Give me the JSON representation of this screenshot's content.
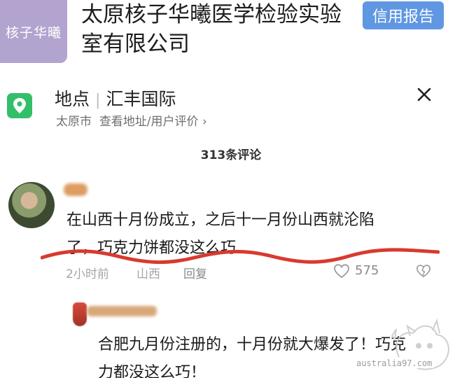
{
  "company": {
    "logo_text": "核子华曦",
    "name": "太原核子华曦医学检验实验室有限公司",
    "credit_button": "信用报告"
  },
  "location": {
    "label": "地点",
    "name": "汇丰国际",
    "city": "太原市",
    "links": "查看地址/用户评价",
    "chevron": "›",
    "icon": "map-pin-icon",
    "accent": "#33bf6a"
  },
  "comments": {
    "count": "313条评论",
    "main": {
      "text": "在山西十月份成立，之后十一月份山西就沦陷了，巧克力饼都没这么巧",
      "time": "2小时前",
      "region": "山西",
      "reply_label": "回复",
      "likes": "575"
    },
    "reply": {
      "text": "合肥九月份注册的，十月份就大爆发了！巧克力都没这么巧！"
    }
  },
  "watermark": {
    "text": "australia97.com"
  },
  "colors": {
    "credit_button": "#5f97e3",
    "logo_bg": "#b3a3cf",
    "underline": "#d83a2e"
  }
}
